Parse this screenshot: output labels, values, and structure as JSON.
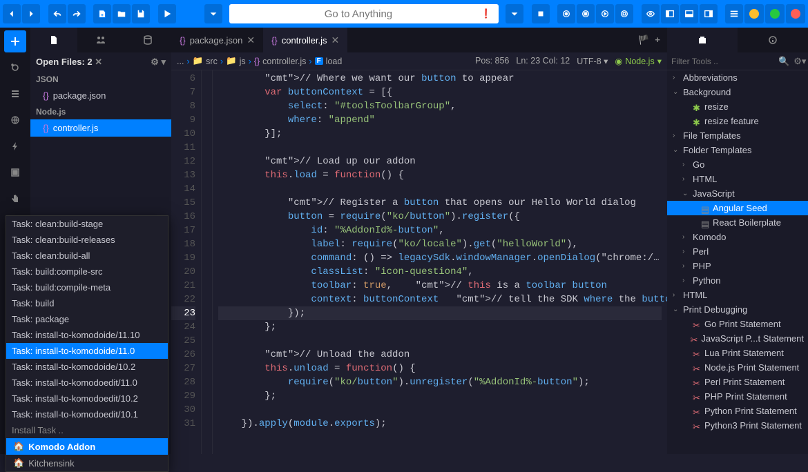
{
  "toolbar": {
    "search_placeholder": "Go to Anything"
  },
  "left_strip": {
    "items": [
      "plus",
      "activity",
      "list",
      "globe",
      "bolt",
      "box",
      "hand",
      "trash",
      "file",
      "book"
    ]
  },
  "open_files": {
    "title": "Open Files: 2",
    "groups": [
      {
        "label": "JSON",
        "files": [
          {
            "name": "package.json",
            "active": false
          }
        ]
      },
      {
        "label": "Node.js",
        "files": [
          {
            "name": "controller.js",
            "active": true
          }
        ]
      }
    ]
  },
  "task_popup": {
    "items": [
      "Task: clean:build-stage",
      "Task: clean:build-releases",
      "Task: clean:build-all",
      "Task: build:compile-src",
      "Task: build:compile-meta",
      "Task: build",
      "Task: package",
      "Task: install-to-komodoide/11.10",
      "Task: install-to-komodoide/11.0",
      "Task: install-to-komodoide/10.2",
      "Task: install-to-komodoedit/11.0",
      "Task: install-to-komodoedit/10.2",
      "Task: install-to-komodoedit/10.1"
    ],
    "active_index": 8,
    "input": "Install Task ..",
    "footer1": "Komodo Addon",
    "footer2": "Kitchensink"
  },
  "editor_tabs": [
    {
      "name": "package.json",
      "active": false
    },
    {
      "name": "controller.js",
      "active": true
    }
  ],
  "breadcrumb": {
    "parts": [
      "...",
      "src",
      "js",
      "controller.js",
      "load"
    ],
    "pos": "Pos: 856",
    "lncol": "Ln: 23 Col: 12",
    "enc": "UTF-8",
    "lang": "Node.js"
  },
  "code": {
    "first_line": 6,
    "current_line": 23,
    "lines": [
      "        // Where we want our button to appear",
      "        var buttonContext = [{",
      "            select: \"#toolsToolbarGroup\",",
      "            where: \"append\"",
      "        }];",
      "",
      "        // Load up our addon",
      "        this.load = function() {",
      "",
      "            // Register a button that opens our Hello World dialog",
      "            button = require(\"ko/button\").register({",
      "                id: \"%AddonId%-button\",",
      "                label: require(\"ko/locale\").get(\"helloWorld\"),",
      "                command: () => legacySdk.windowManager.openDialog(\"chrome:/…",
      "                classList: \"icon-question4\",",
      "                toolbar: true,    // this is a toolbar button",
      "                context: buttonContext   // tell the SDK where the button sho…",
      "            });",
      "        };",
      "",
      "        // Unload the addon",
      "        this.unload = function() {",
      "            require(\"ko/button\").unregister(\"%AddonId%-button\");",
      "        };",
      "",
      "    }).apply(module.exports);"
    ]
  },
  "right_panel": {
    "filter_placeholder": "Filter Tools ..",
    "tree": [
      {
        "level": 1,
        "label": "Abbreviations",
        "chev": "›",
        "icon": ""
      },
      {
        "level": 1,
        "label": "Background",
        "chev": "⌄",
        "icon": ""
      },
      {
        "level": 2,
        "label": "resize",
        "chev": "",
        "icon": "puzzle"
      },
      {
        "level": 2,
        "label": "resize feature",
        "chev": "",
        "icon": "puzzle"
      },
      {
        "level": 1,
        "label": "File Templates",
        "chev": "›",
        "icon": ""
      },
      {
        "level": 1,
        "label": "Folder Templates",
        "chev": "⌄",
        "icon": ""
      },
      {
        "level": 2,
        "label": "Go",
        "chev": "›",
        "icon": ""
      },
      {
        "level": 2,
        "label": "HTML",
        "chev": "›",
        "icon": ""
      },
      {
        "level": 2,
        "label": "JavaScript",
        "chev": "⌄",
        "icon": ""
      },
      {
        "level": 3,
        "label": "Angular Seed",
        "chev": "",
        "icon": "doc",
        "active": true
      },
      {
        "level": 3,
        "label": "React Boilerplate",
        "chev": "",
        "icon": "doc"
      },
      {
        "level": 2,
        "label": "Komodo",
        "chev": "›",
        "icon": ""
      },
      {
        "level": 2,
        "label": "Perl",
        "chev": "›",
        "icon": ""
      },
      {
        "level": 2,
        "label": "PHP",
        "chev": "›",
        "icon": ""
      },
      {
        "level": 2,
        "label": "Python",
        "chev": "›",
        "icon": ""
      },
      {
        "level": 1,
        "label": "HTML",
        "chev": "›",
        "icon": ""
      },
      {
        "level": 1,
        "label": "Print Debugging",
        "chev": "⌄",
        "icon": ""
      },
      {
        "level": 2,
        "label": "Go Print Statement",
        "chev": "",
        "icon": "scissors"
      },
      {
        "level": 2,
        "label": "JavaScript P...t Statement",
        "chev": "",
        "icon": "scissors"
      },
      {
        "level": 2,
        "label": "Lua Print Statement",
        "chev": "",
        "icon": "scissors"
      },
      {
        "level": 2,
        "label": "Node.js Print Statement",
        "chev": "",
        "icon": "scissors"
      },
      {
        "level": 2,
        "label": "Perl Print Statement",
        "chev": "",
        "icon": "scissors"
      },
      {
        "level": 2,
        "label": "PHP Print Statement",
        "chev": "",
        "icon": "scissors"
      },
      {
        "level": 2,
        "label": "Python Print Statement",
        "chev": "",
        "icon": "scissors"
      },
      {
        "level": 2,
        "label": "Python3 Print Statement",
        "chev": "",
        "icon": "scissors"
      }
    ]
  }
}
